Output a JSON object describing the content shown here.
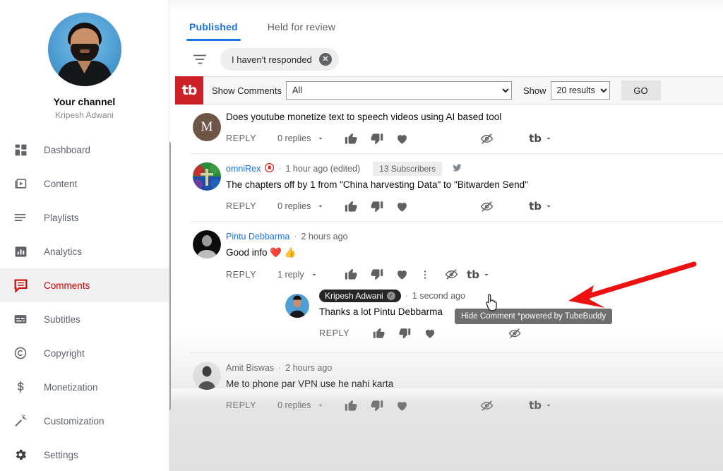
{
  "sidebar": {
    "channel": {
      "avatar_alt": "channel-avatar",
      "title": "Your channel",
      "name": "Kripesh Adwani"
    },
    "items": [
      {
        "label": "Dashboard",
        "icon": "dashboard-icon",
        "active": false
      },
      {
        "label": "Content",
        "icon": "content-icon",
        "active": false
      },
      {
        "label": "Playlists",
        "icon": "playlists-icon",
        "active": false
      },
      {
        "label": "Analytics",
        "icon": "analytics-icon",
        "active": false
      },
      {
        "label": "Comments",
        "icon": "comments-icon",
        "active": true
      },
      {
        "label": "Subtitles",
        "icon": "subtitles-icon",
        "active": false
      },
      {
        "label": "Copyright",
        "icon": "copyright-icon",
        "active": false
      },
      {
        "label": "Monetization",
        "icon": "monetization-icon",
        "active": false
      },
      {
        "label": "Customization",
        "icon": "customization-icon",
        "active": false
      },
      {
        "label": "Settings",
        "icon": "settings-icon",
        "active": false
      }
    ],
    "active_color": "#cc0000"
  },
  "tabs": [
    {
      "label": "Published",
      "active": true
    },
    {
      "label": "Held for review",
      "active": false
    }
  ],
  "filter": {
    "filter_icon": "filter-icon",
    "chip_label": "I haven't responded",
    "chip_remove_icon": "close-circle-icon"
  },
  "tubebuddy_bar": {
    "logo_text": "tb",
    "logo_color": "#cc2127",
    "show_comments_label": "Show Comments",
    "show_comments_value": "All",
    "show_comments_options": [
      "All"
    ],
    "show_label": "Show",
    "results_value": "20 results",
    "results_options": [
      "20 results"
    ],
    "go_label": "GO"
  },
  "comments": [
    {
      "avatar_kind": "letter",
      "avatar_letter": "M",
      "avatar_color": "#6d5646",
      "author": "",
      "author_style": "hidden",
      "time": "",
      "badge": "",
      "text": "Does youtube monetize text to speech videos using AI based tool",
      "reply_label": "REPLY",
      "replies_label": "0 replies",
      "has_overflow_menu": false,
      "partial_top": true
    },
    {
      "avatar_kind": "graphic-globe",
      "author": "omniRex",
      "author_style": "link",
      "author_ring": true,
      "time": "1 hour ago (edited)",
      "badge": "13 Subscribers",
      "badge_extra_icon": "twitter-icon",
      "text": "The chapters off by 1 from \"China harvesting Data\" to \"Bitwarden Send\"",
      "reply_label": "REPLY",
      "replies_label": "0 replies",
      "has_overflow_menu": false
    },
    {
      "avatar_kind": "graphic-person-dark",
      "author": "Pintu Debbarma",
      "author_style": "link",
      "time": "2 hours ago",
      "badge": "",
      "text": "Good info ❤️ 👍",
      "reply_label": "REPLY",
      "replies_label": "1 reply",
      "has_overflow_menu": true,
      "reply": {
        "avatar_kind": "graphic-person-blue",
        "author": "Kripesh Adwani",
        "author_style": "owner-chip",
        "verified_icon": "verified-icon",
        "time": "1 second ago",
        "text": "Thanks a lot Pintu Debbarma",
        "reply_label": "REPLY"
      }
    },
    {
      "avatar_kind": "graphic-person-grey",
      "author": "Amit Biswas",
      "author_style": "plain",
      "time": "2 hours ago",
      "badge": "",
      "text": "Me to phone par VPN use he nahi karta",
      "reply_label": "REPLY",
      "replies_label": "0 replies",
      "has_overflow_menu": false
    }
  ],
  "action_icons": {
    "like": "thumbs-up-icon",
    "dislike": "thumbs-down-icon",
    "heart": "heart-icon",
    "overflow": "more-vertical-icon",
    "hide": "eye-slash-icon",
    "tubebuddy": "tb",
    "tubebuddy_chevron": "chevron-down-icon"
  },
  "tooltip": {
    "text": "Hide Comment *powered by TubeBuddy"
  },
  "annotation": {
    "arrow_color": "#ee1111",
    "arrow_name": "red-arrow-annotation"
  }
}
